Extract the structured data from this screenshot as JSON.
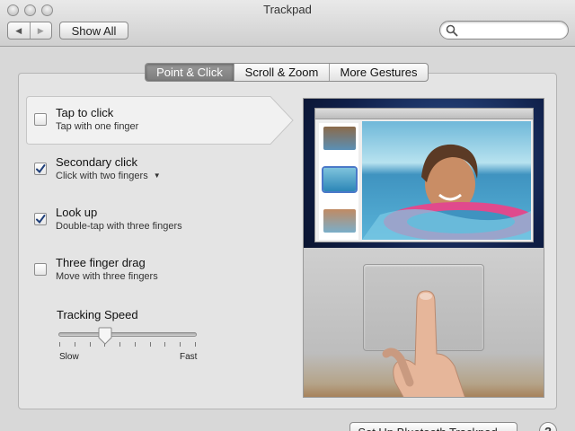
{
  "window": {
    "title": "Trackpad"
  },
  "toolbar": {
    "back_label": "◀",
    "forward_label": "▶",
    "show_all_label": "Show All",
    "search_placeholder": ""
  },
  "tabs": [
    {
      "label": "Point & Click",
      "active": true
    },
    {
      "label": "Scroll & Zoom",
      "active": false
    },
    {
      "label": "More Gestures",
      "active": false
    }
  ],
  "options": [
    {
      "title": "Tap to click",
      "subtitle": "Tap with one finger",
      "checked": false,
      "selected": true
    },
    {
      "title": "Secondary click",
      "subtitle": "Click with two fingers",
      "checked": true,
      "has_dropdown": true
    },
    {
      "title": "Look up",
      "subtitle": "Double-tap with three fingers",
      "checked": true
    },
    {
      "title": "Three finger drag",
      "subtitle": "Move with three fingers",
      "checked": false
    }
  ],
  "tracking": {
    "label": "Tracking Speed",
    "min_label": "Slow",
    "max_label": "Fast",
    "value_fraction": 0.34,
    "tick_count": 10
  },
  "footer": {
    "setup_label": "Set Up Bluetooth Trackpad…",
    "help_label": "?"
  },
  "colors": {
    "selected_tab": "#8a8a8a",
    "check": "#1f3f7a"
  }
}
